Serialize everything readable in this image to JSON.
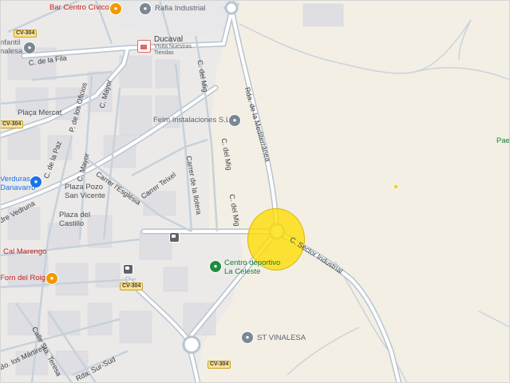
{
  "map": {
    "colors": {
      "land": "#f3efe4",
      "urban": "#eceae8",
      "road": "#ffffff",
      "road_edge": "#b8c4d0",
      "highlight": "#ffdd00",
      "poi_green": "#188038",
      "poi_blue": "#1a73e8"
    },
    "pois": {
      "bar_centro_civico": "Bar Centro Cívico",
      "rafia_industrial": "Rafia Industrial",
      "ducaval": "Ducaval",
      "ducaval_sub": "Visita Nuestras Tiendas",
      "felm": "Felm Instalaciones S.L.",
      "centro_deportivo_1": "Centro deportivo",
      "centro_deportivo_2": "La Celeste",
      "st_vinalesa": "ST VINALESA",
      "verduras_1": "Verduras",
      "verduras_2": "Danavarro",
      "cal_marengo": "Cal Marengo",
      "forn_del_roig": "Forn del Roig",
      "infantil_1": "nfantil",
      "infantil_2": "nalesa",
      "pael": "Pael"
    },
    "plazas": {
      "plaza_mercat": "Plaça Mercat",
      "plaza_pozo_1": "Plaza Pozo",
      "plaza_pozo_2": "San Vicente",
      "plaza_castillo_1": "Plaza del",
      "plaza_castillo_2": "Castillo"
    },
    "streets": {
      "c_de_la_fila": "C. de la Fila",
      "c_mayor_1": "C. Mayor",
      "c_mayor_2": "C. Mayor",
      "p_oficios": "P. de los Oficios",
      "c_la_paz": "C. de la Paz",
      "carrer_esglesia": "Carrer l'Església",
      "carrer_teixel": "Carrer Teixel",
      "carrer_llotera": "Carrer de la llotera",
      "c_del_mig_1": "C. del Mig",
      "c_del_mig_2": "C. del Mig",
      "c_del_mig_3": "C. del Mig",
      "rda_mediterranea": "Rda. de la Mediterránea",
      "c_sector_industrial": "C. Sector Industrial",
      "dre_vedruna": "dre Vedruna",
      "calle_sta_teresa": "Calle Sta. Teresa",
      "bo_martires": "Bo. los Mártires",
      "rda_sur_sud": "Rda. Sur-Sud"
    },
    "shields": {
      "cv304_a": "CV-304",
      "cv304_b": "CV-304",
      "cv304_c": "CV-304",
      "cv304_d": "CV-304"
    }
  }
}
